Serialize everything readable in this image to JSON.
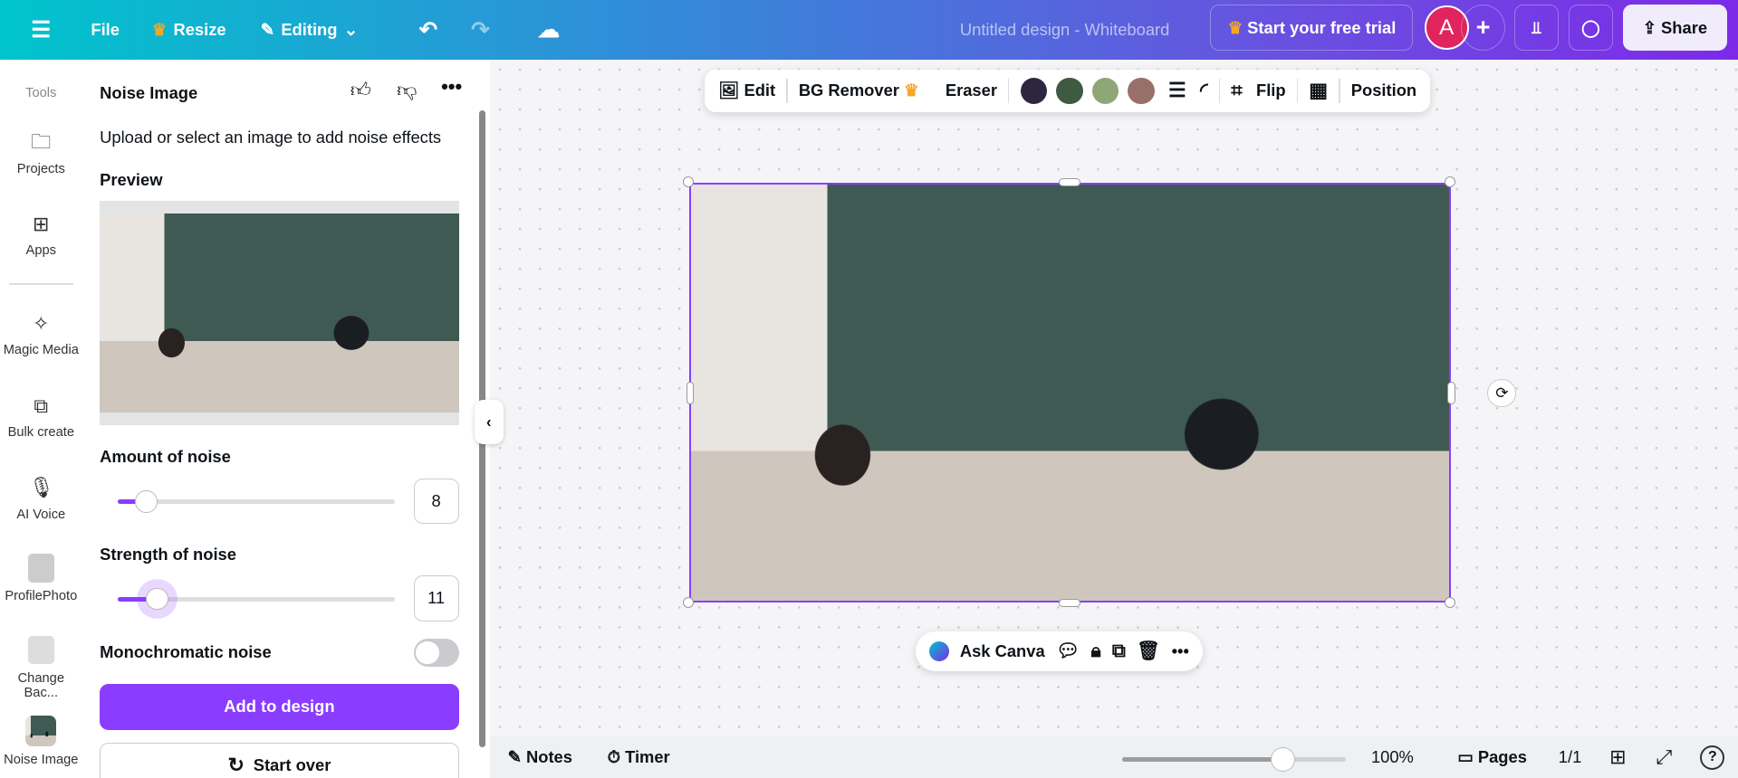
{
  "topbar": {
    "file": "File",
    "resize": "Resize",
    "editing": "Editing",
    "title": "Untitled design - Whiteboard",
    "trial": "Start your free trial",
    "avatar": "A",
    "share": "Share"
  },
  "rail": {
    "tools": "Tools",
    "items": [
      {
        "label": "Projects"
      },
      {
        "label": "Apps"
      },
      {
        "label": "Magic Media"
      },
      {
        "label": "Bulk create"
      },
      {
        "label": "AI Voice"
      },
      {
        "label": "ProfilePhoto"
      },
      {
        "label": "Change Bac..."
      },
      {
        "label": "Noise Image"
      }
    ]
  },
  "panel": {
    "title": "Noise Image",
    "description": "Upload or select an image to add noise effects",
    "preview": "Preview",
    "amount_label": "Amount of noise",
    "amount_value": "8",
    "amount_fraction": 0.08,
    "strength_label": "Strength of noise",
    "strength_value": "11",
    "strength_fraction": 0.11,
    "mono_label": "Monochromatic noise",
    "mono_on": false,
    "add": "Add to design",
    "start_over": "Start over"
  },
  "toolbar": {
    "edit": "Edit",
    "bg_remover": "BG Remover",
    "eraser": "Eraser",
    "colors": [
      "#2e2640",
      "#3e5a40",
      "#8fa677",
      "#98706a"
    ],
    "flip": "Flip",
    "position": "Position"
  },
  "context": {
    "ask": "Ask Canva"
  },
  "bottom": {
    "notes": "Notes",
    "timer": "Timer",
    "zoom": "100%",
    "zoom_fraction": 0.72,
    "pages": "Pages",
    "page_count": "1/1"
  }
}
